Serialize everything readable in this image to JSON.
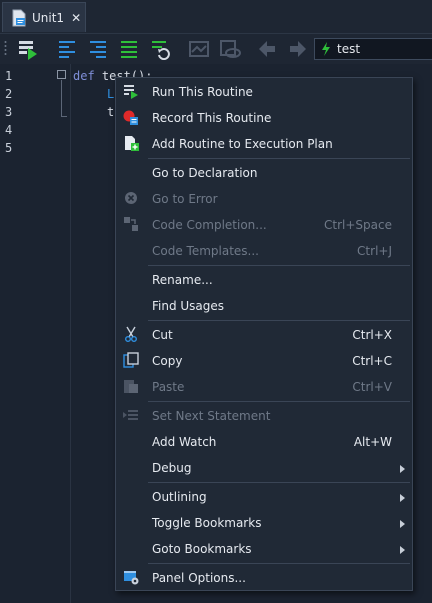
{
  "tab": {
    "label": "Unit1",
    "close": "✕",
    "icon": "file-script-icon"
  },
  "toolbar": {
    "buttons": [
      "run-icon",
      "align-left-icon",
      "align-center-icon",
      "align-justify-icon",
      "undo-format-icon",
      "view-disabled-icon",
      "preview-disabled-icon",
      "back-arrow-icon",
      "forward-arrow-icon"
    ],
    "routine_combo": {
      "value": "test"
    }
  },
  "editor": {
    "line_numbers": [
      "1",
      "2",
      "3",
      "4",
      "5"
    ],
    "lines": [
      {
        "keyword": "def",
        "text": " test():"
      },
      {
        "keyword": "",
        "text": "L"
      },
      {
        "keyword": "",
        "text": "t"
      }
    ]
  },
  "context_menu": {
    "items": [
      {
        "label": "Run This Routine",
        "shortcut": "",
        "disabled": false,
        "submenu": false,
        "icon": "run-routine-icon"
      },
      {
        "label": "Record This Routine",
        "shortcut": "",
        "disabled": false,
        "submenu": false,
        "icon": "record-routine-icon"
      },
      {
        "label": "Add Routine to Execution Plan",
        "shortcut": "",
        "disabled": false,
        "submenu": false,
        "icon": "add-to-plan-icon"
      },
      {
        "label": "Go to Declaration",
        "shortcut": "",
        "disabled": false,
        "submenu": false,
        "icon": ""
      },
      {
        "label": "Go to Error",
        "shortcut": "",
        "disabled": true,
        "submenu": false,
        "icon": "error-icon"
      },
      {
        "label": "Code Completion...",
        "shortcut": "Ctrl+Space",
        "disabled": true,
        "submenu": false,
        "icon": "code-completion-icon"
      },
      {
        "label": "Code Templates...",
        "shortcut": "Ctrl+J",
        "disabled": true,
        "submenu": false,
        "icon": ""
      },
      {
        "label": "Rename...",
        "shortcut": "",
        "disabled": false,
        "submenu": false,
        "icon": ""
      },
      {
        "label": "Find Usages",
        "shortcut": "",
        "disabled": false,
        "submenu": false,
        "icon": ""
      },
      {
        "label": "Cut",
        "shortcut": "Ctrl+X",
        "disabled": false,
        "submenu": false,
        "icon": "scissors-icon"
      },
      {
        "label": "Copy",
        "shortcut": "Ctrl+C",
        "disabled": false,
        "submenu": false,
        "icon": "copy-icon"
      },
      {
        "label": "Paste",
        "shortcut": "Ctrl+V",
        "disabled": true,
        "submenu": false,
        "icon": "paste-icon"
      },
      {
        "label": "Set Next Statement",
        "shortcut": "",
        "disabled": true,
        "submenu": false,
        "icon": "set-next-statement-icon"
      },
      {
        "label": "Add Watch",
        "shortcut": "Alt+W",
        "disabled": false,
        "submenu": false,
        "icon": ""
      },
      {
        "label": "Debug",
        "shortcut": "",
        "disabled": false,
        "submenu": true,
        "icon": ""
      },
      {
        "label": "Outlining",
        "shortcut": "",
        "disabled": false,
        "submenu": true,
        "icon": ""
      },
      {
        "label": "Toggle Bookmarks",
        "shortcut": "",
        "disabled": false,
        "submenu": true,
        "icon": ""
      },
      {
        "label": "Goto Bookmarks",
        "shortcut": "",
        "disabled": false,
        "submenu": true,
        "icon": ""
      },
      {
        "label": "Panel Options...",
        "shortcut": "",
        "disabled": false,
        "submenu": false,
        "icon": "panel-options-icon"
      }
    ]
  },
  "colors": {
    "background": "#1b2330",
    "menu": "#202936",
    "accent_green": "#2fbf3a",
    "accent_blue": "#2f8fe0",
    "keyword": "#7f8fd8"
  }
}
